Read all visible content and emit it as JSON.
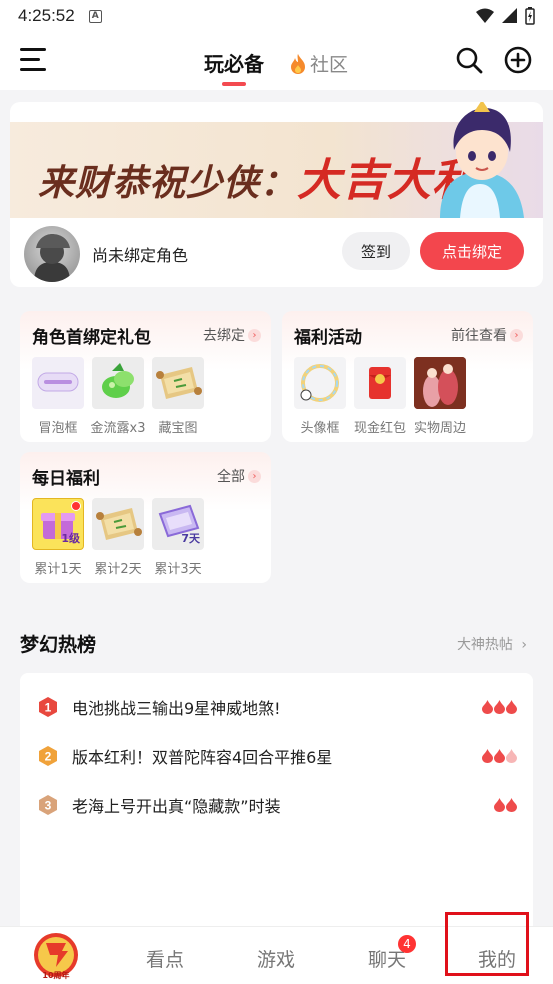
{
  "status_bar": {
    "time": "4:25:52",
    "badge": "A"
  },
  "header": {
    "tab_main": "玩必备",
    "tab_community": "社区"
  },
  "banner": {
    "text_prefix": "来财恭祝少侠：",
    "text_highlight": "大吉大利"
  },
  "profile": {
    "name": "尚未绑定角色",
    "sign_button": "签到",
    "bind_button": "点击绑定"
  },
  "role_gift": {
    "title": "角色首绑定礼包",
    "more": "去绑定",
    "items": [
      {
        "label": "冒泡框"
      },
      {
        "label": "金流露x3"
      },
      {
        "label": "藏宝图"
      }
    ]
  },
  "welfare": {
    "title": "福利活动",
    "more": "前往查看",
    "items": [
      {
        "label": "头像框"
      },
      {
        "label": "现金红包"
      },
      {
        "label": "实物周边"
      }
    ]
  },
  "daily": {
    "title": "每日福利",
    "more": "全部",
    "items": [
      {
        "label": "累计1天",
        "badge": "1级"
      },
      {
        "label": "累计2天"
      },
      {
        "label": "累计3天",
        "badge": "7天"
      }
    ]
  },
  "hot": {
    "title": "梦幻热榜",
    "more": "大神热帖",
    "items": [
      {
        "rank": "1",
        "text": "电池挑战三输出9星神威地煞!",
        "heat": 3
      },
      {
        "rank": "2",
        "text": "版本红利！双普陀阵容4回合平推6星",
        "heat": 2.5
      },
      {
        "rank": "3",
        "text": "老海上号开出真“隐藏款”时装",
        "heat": 2
      }
    ]
  },
  "tabbar": {
    "logo_text": "10周年",
    "items": [
      "看点",
      "游戏",
      "聊天",
      "我的"
    ],
    "chat_badge": "4"
  },
  "colors": {
    "accent": "#f3464d",
    "rank1": "#e8483e",
    "rank2": "#f0a23a",
    "rank3": "#d9a37a"
  }
}
